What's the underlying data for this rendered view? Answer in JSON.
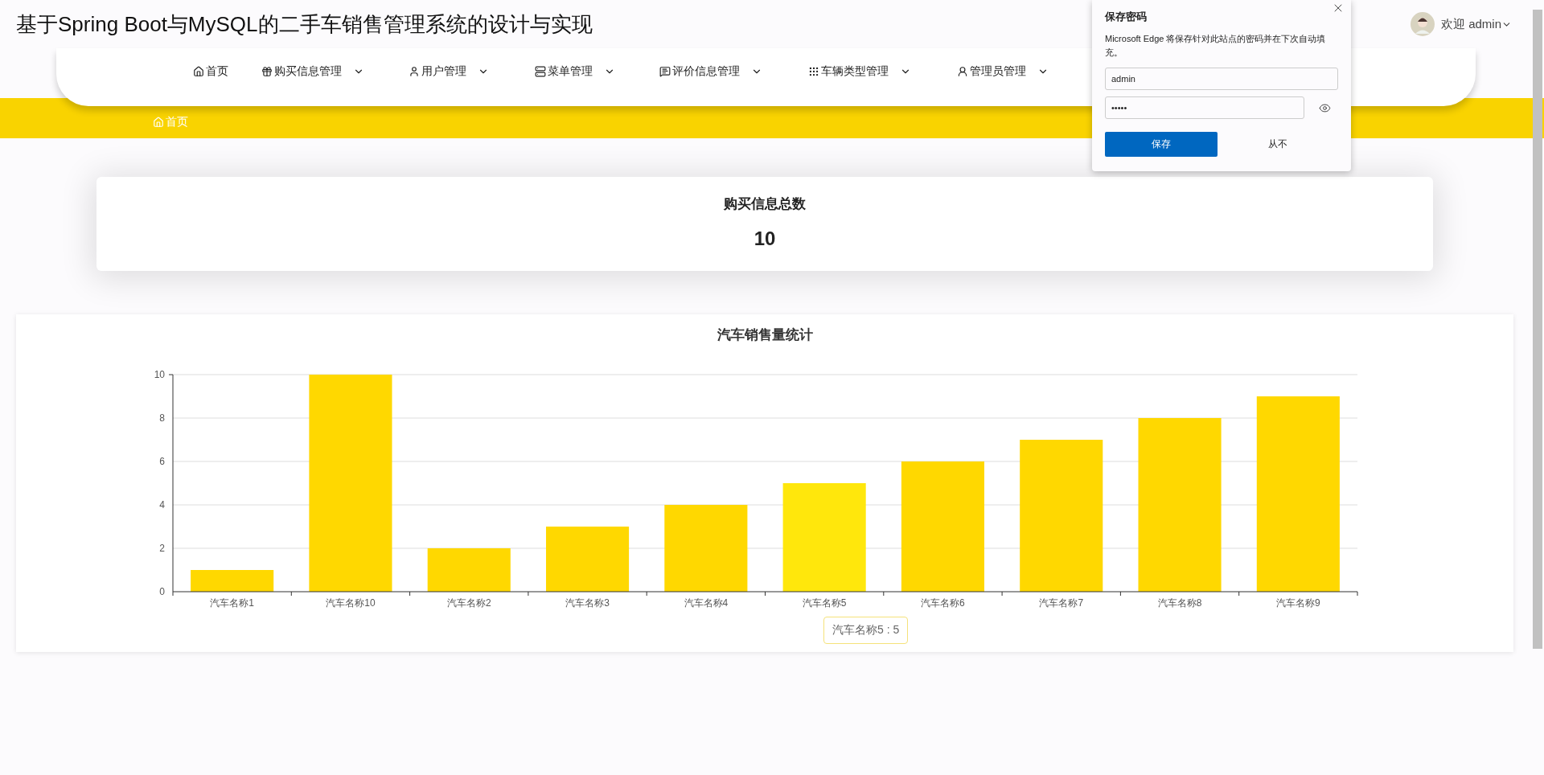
{
  "header": {
    "title": "基于Spring Boot与MySQL的二手车销售管理系统的设计与实现",
    "user": {
      "greeting": "欢迎 admin"
    }
  },
  "nav": [
    {
      "label": "首页",
      "has_menu": false
    },
    {
      "label": "购买信息管理",
      "has_menu": true
    },
    {
      "label": "用户管理",
      "has_menu": true
    },
    {
      "label": "菜单管理",
      "has_menu": true
    },
    {
      "label": "评价信息管理",
      "has_menu": true
    },
    {
      "label": "车辆类型管理",
      "has_menu": true
    },
    {
      "label": "管理员管理",
      "has_menu": true
    }
  ],
  "breadcrumb": "首页",
  "stat": {
    "title": "购买信息总数",
    "value": "10"
  },
  "chart": {
    "title": "汽车销售量统计",
    "tooltip": "汽车名称5 : 5",
    "chart_data": {
      "type": "bar",
      "categories": [
        "汽车名称1",
        "汽车名称10",
        "汽车名称2",
        "汽车名称3",
        "汽车名称4",
        "汽车名称5",
        "汽车名称6",
        "汽车名称7",
        "汽车名称8",
        "汽车名称9"
      ],
      "series": [
        {
          "color": "#ffd800",
          "values": [
            1,
            10,
            2,
            3,
            4,
            5,
            6,
            7,
            8,
            9
          ]
        }
      ],
      "grid": true,
      "ylim": [
        0,
        10
      ],
      "yticks": [
        0,
        2,
        4,
        6,
        8,
        10
      ]
    }
  },
  "password_popup": {
    "title": "保存密码",
    "message": "Microsoft Edge 将保存针对此站点的密码并在下次自动填充。",
    "username": "admin",
    "password": "•••••",
    "save": "保存",
    "never": "从不"
  }
}
